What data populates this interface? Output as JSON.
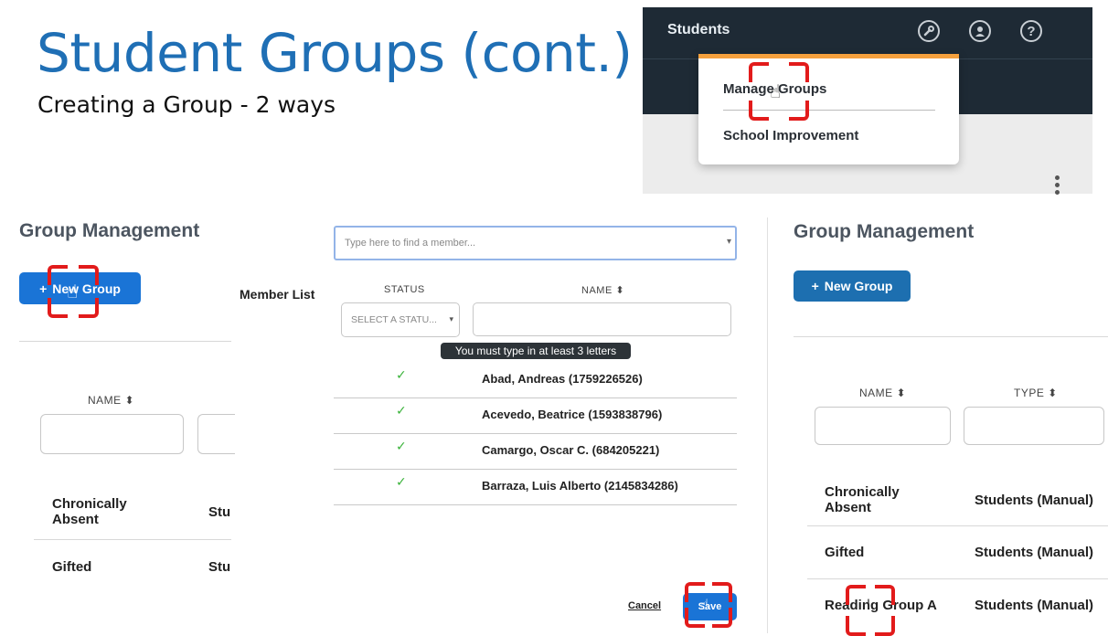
{
  "slide": {
    "title": "Student Groups (cont.)",
    "subtitle": "Creating a Group - 2 ways"
  },
  "topbar": {
    "title": "Students",
    "icons": [
      "wrench-icon",
      "user-circle-icon",
      "help-circle-icon"
    ],
    "menu_items": [
      "Manage Groups",
      "School Improvement"
    ],
    "accent_color": "#f5a03c",
    "background": "#1e2a35"
  },
  "left_panel": {
    "title": "Group Management",
    "new_group_label": "New Group",
    "name_header": "NAME",
    "rows": [
      {
        "name": "Chronically\nAbsent",
        "type": "Stu"
      },
      {
        "name": "Gifted",
        "type": "Stu"
      }
    ]
  },
  "middle_panel": {
    "search_placeholder": "Type here to find a member...",
    "member_list_label": "Member List",
    "status_header": "STATUS",
    "name_header": "NAME",
    "status_placeholder": "SELECT A STATU...",
    "tooltip": "You must type in at least 3 letters",
    "members": [
      "Abad, Andreas (1759226526)",
      "Acevedo, Beatrice (1593838796)",
      "Camargo, Oscar C. (684205221)",
      "Barraza, Luis Alberto (2145834286)"
    ],
    "cancel_label": "Cancel",
    "save_label": "Save"
  },
  "right_panel": {
    "title": "Group Management",
    "new_group_label": "New Group",
    "name_header": "NAME",
    "type_header": "TYPE",
    "rows": [
      {
        "name": "Chronically\nAbsent",
        "type": "Students (Manual)"
      },
      {
        "name": "Gifted",
        "type": "Students (Manual)"
      },
      {
        "name": "Reading Group A",
        "type": "Students (Manual)"
      }
    ]
  },
  "colors": {
    "title_blue": "#1f6fb5",
    "button_blue": "#1a74d6",
    "marker_red": "#e21b1b",
    "check_green": "#3bb33b"
  }
}
